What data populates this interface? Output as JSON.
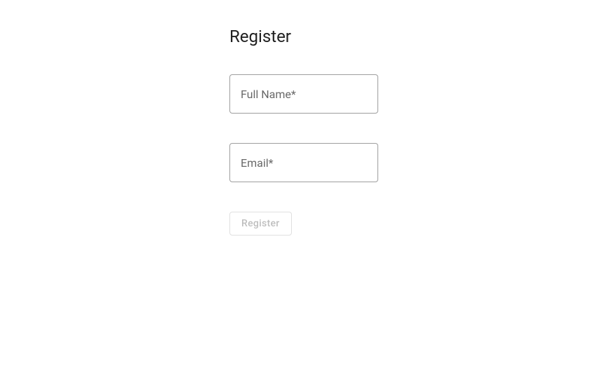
{
  "page": {
    "title": "Register"
  },
  "form": {
    "fullName": {
      "placeholder": "Full Name*",
      "value": ""
    },
    "email": {
      "placeholder": "Email*",
      "value": ""
    },
    "submit": {
      "label": "Register"
    }
  }
}
